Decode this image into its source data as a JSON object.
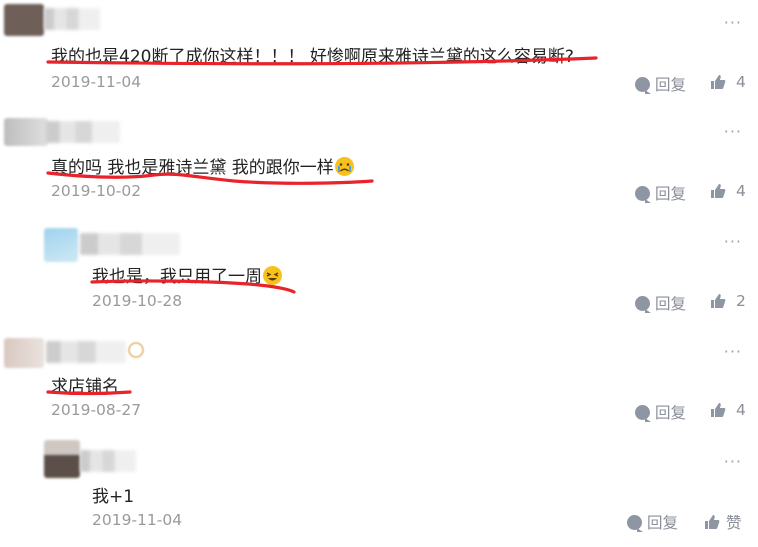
{
  "comments": [
    {
      "text": "我的也是420断了成你这样！！！ 好惨啊原来雅诗兰黛的这么容易断?",
      "date": "2019-11-04",
      "reply_label": "回复",
      "like_count": "4"
    },
    {
      "text": "真的吗 我也是雅诗兰黛 我的跟你一样",
      "date": "2019-10-02",
      "reply_label": "回复",
      "like_count": "4"
    },
    {
      "text": "我也是，我只用了一周",
      "date": "2019-10-28",
      "reply_label": "回复",
      "like_count": "2"
    },
    {
      "text": "求店铺名",
      "date": "2019-08-27",
      "reply_label": "回复",
      "like_count": "4"
    },
    {
      "text": "我+1",
      "date": "2019-11-04",
      "reply_label": "回复",
      "like_label": "赞"
    }
  ],
  "more_label": "···",
  "colors": {
    "underline": "#e8232a",
    "meta": "#8a8f99",
    "date": "#9a9a9a"
  }
}
